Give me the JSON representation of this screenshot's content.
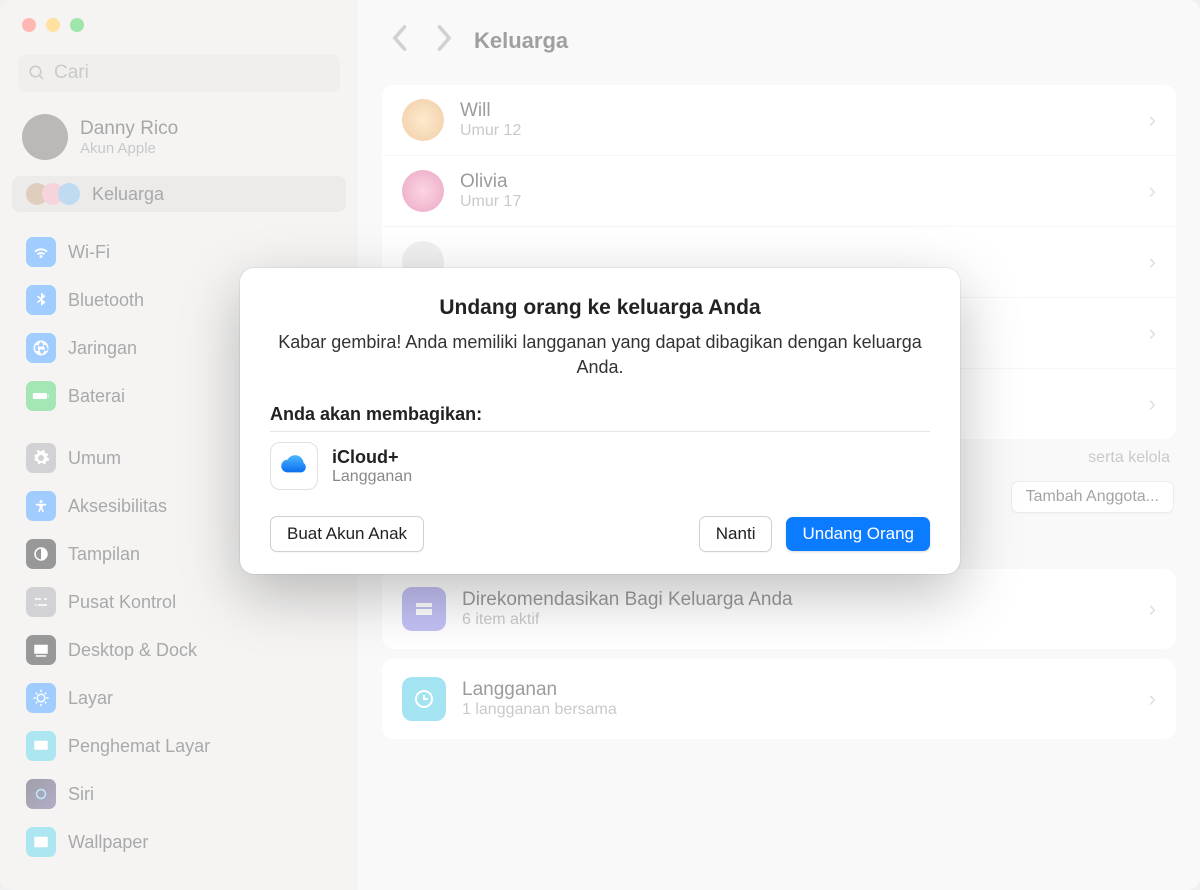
{
  "window": {
    "search_placeholder": "Cari",
    "account_name": "Danny Rico",
    "account_sub": "Akun Apple",
    "page_title": "Keluarga"
  },
  "sidebar": {
    "items": [
      {
        "label": "Keluarga"
      },
      {
        "label": "Wi-Fi"
      },
      {
        "label": "Bluetooth"
      },
      {
        "label": "Jaringan"
      },
      {
        "label": "Baterai"
      },
      {
        "label": "Umum"
      },
      {
        "label": "Aksesibilitas"
      },
      {
        "label": "Tampilan"
      },
      {
        "label": "Pusat Kontrol"
      },
      {
        "label": "Desktop & Dock"
      },
      {
        "label": "Layar"
      },
      {
        "label": "Penghemat Layar"
      },
      {
        "label": "Siri"
      },
      {
        "label": "Wallpaper"
      }
    ]
  },
  "members": [
    {
      "name": "Will",
      "sub": "Umur 12",
      "color": "#f0b060"
    },
    {
      "name": "Olivia",
      "sub": "Umur 17",
      "color": "#e66aa8"
    },
    {
      "name": "",
      "sub": ""
    },
    {
      "name": "",
      "sub": ""
    },
    {
      "name": "",
      "sub": ""
    }
  ],
  "note": "serta kelola",
  "add_member": "Tambah Anggota...",
  "recommend": {
    "title": "Direkomendasikan Bagi Keluarga Anda",
    "sub": "6 item aktif"
  },
  "subscription": {
    "title": "Langganan",
    "sub": "1 langganan bersama"
  },
  "modal": {
    "title": "Undang orang ke keluarga Anda",
    "sub": "Kabar gembira! Anda memiliki langganan yang dapat dibagikan dengan keluarga Anda.",
    "share_label": "Anda akan membagikan:",
    "item_name": "iCloud+",
    "item_type": "Langganan",
    "btn_child": "Buat Akun Anak",
    "btn_later": "Nanti",
    "btn_invite": "Undang Orang"
  }
}
